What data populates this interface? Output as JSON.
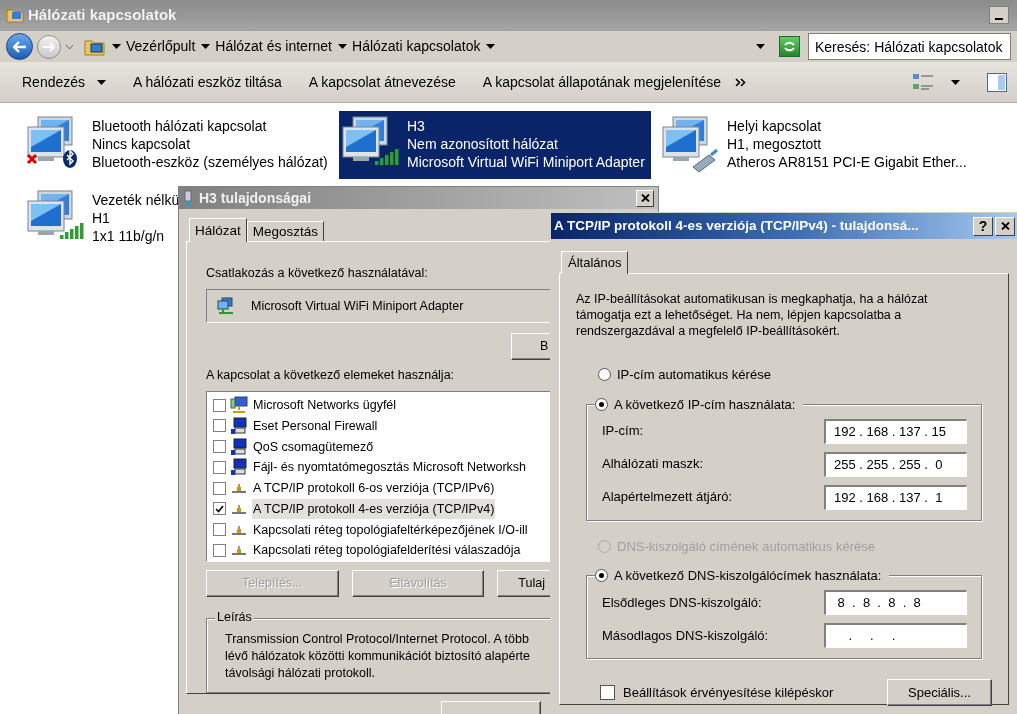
{
  "window": {
    "title": "Hálózati kapcsolatok"
  },
  "address_bar": {
    "breadcrumb": [
      "Vezérlőpult",
      "Hálózat és internet",
      "Hálózati kapcsolatok"
    ],
    "search": {
      "placeholder": "Keresés: Hálózati kapcsolatok"
    }
  },
  "toolbar": {
    "items": [
      {
        "label": "Rendezés",
        "dropdown": true
      },
      {
        "label": "A hálózati eszköz tiltása",
        "dropdown": false
      },
      {
        "label": "A kapcsolat átnevezése",
        "dropdown": false
      },
      {
        "label": "A kapcsolat állapotának megjelenítése",
        "dropdown": false
      }
    ]
  },
  "connections": [
    {
      "kind": "bluetooth",
      "name": "Bluetooth hálózati kapcsolat",
      "status": "Nincs kapcsolat",
      "device": "Bluetooth-eszköz (személyes hálózat)",
      "selected": false
    },
    {
      "kind": "wifi",
      "name": "H3",
      "status": "Nem azonosított hálózat",
      "device": "Microsoft Virtual WiFi Miniport Adapter",
      "selected": true
    },
    {
      "kind": "ethernet",
      "name": "Helyi kapcsolat",
      "status": "H1, megosztott",
      "device": "Atheros AR8151 PCI-E Gigabit Ether...",
      "selected": false
    },
    {
      "kind": "wifi",
      "name": "Vezeték nélkü",
      "status": "H1",
      "device": "1x1 11b/g/n",
      "selected": false
    }
  ],
  "properties_dialog": {
    "title": "H3 tulajdonságai",
    "tabs": [
      {
        "label": "Hálózat",
        "selected": true
      },
      {
        "label": "Megosztás",
        "selected": false
      }
    ],
    "connect_label": "Csatlakozás a következő használatával:",
    "adapter": "Microsoft Virtual WiFi Miniport Adapter",
    "configure_button": "B",
    "components_label": "A kapcsolat a következő elemeket használja:",
    "components": [
      {
        "kind": "client",
        "label": "Microsoft Networks ügyfél",
        "checked": false,
        "selected": false
      },
      {
        "kind": "service",
        "label": "Eset Personal Firewall",
        "checked": false,
        "selected": false
      },
      {
        "kind": "service",
        "label": "QoS csomagütemező",
        "checked": false,
        "selected": false
      },
      {
        "kind": "service",
        "label": "Fájl- és nyomtatómegosztás Microsoft Networksh",
        "checked": false,
        "selected": false
      },
      {
        "kind": "protocol",
        "label": "A TCP/IP protokoll 6-os verziója (TCP/IPv6)",
        "checked": false,
        "selected": false
      },
      {
        "kind": "protocol",
        "label": "A TCP/IP protokoll 4-es verziója (TCP/IPv4)",
        "checked": true,
        "selected": true
      },
      {
        "kind": "protocol",
        "label": "Kapcsolati réteg topológiafeltérképezőjének I/O-ill",
        "checked": false,
        "selected": false
      },
      {
        "kind": "protocol",
        "label": "Kapcsolati réteg topológiafelderítési válaszadója",
        "checked": false,
        "selected": false
      }
    ],
    "buttons": [
      {
        "label": "Telepítés...",
        "disabled": true
      },
      {
        "label": "Eltávolítás",
        "disabled": true
      },
      {
        "label": "Tulaj",
        "disabled": false
      }
    ],
    "description": {
      "legend": "Leírás",
      "lines": [
        "Transmission Control Protocol/Internet Protocol. A több",
        "lévő hálózatok közötti kommunikációt biztosító alapérte",
        "távolsági hálózati protokoll."
      ]
    }
  },
  "ipv4_dialog": {
    "title": "A TCP/IP protokoll 4-es verziója (TCP/IPv4) - tulajdonsá...",
    "help_button": "?",
    "tabs": [
      {
        "label": "Általános",
        "selected": true
      }
    ],
    "intro": "Az IP-beállításokat automatikusan is megkaphatja, ha a hálózat támogatja ezt a lehetőséget. Ha nem, lépjen kapcsolatba a rendszergazdával a megfelelő IP-beállításokért.",
    "ip_auto": {
      "label": "IP-cím automatikus kérése",
      "selected": false,
      "disabled": false
    },
    "ip_manual": {
      "label": "A következő IP-cím használata:",
      "selected": true,
      "disabled": false,
      "fields": [
        {
          "label": "IP-cím:",
          "value": "192 . 168 . 137 . 15"
        },
        {
          "label": "Alhálózati maszk:",
          "value": "255 . 255 . 255 .  0"
        },
        {
          "label": "Alapértelmezett átjáró:",
          "value": "192 . 168 . 137 .  1"
        }
      ]
    },
    "dns_auto": {
      "label": "DNS-kiszolgáló címének automatikus kérése",
      "selected": false,
      "disabled": true
    },
    "dns_manual": {
      "label": "A következő DNS-kiszolgálócímek használata:",
      "selected": true,
      "disabled": false,
      "fields": [
        {
          "label": "Elsődleges DNS-kiszolgáló:",
          "value": " 8  .  8  .  8  .  8"
        },
        {
          "label": "Másodlagos DNS-kiszolgáló:",
          "value": "    .     .     ."
        }
      ]
    },
    "validate": {
      "label": "Beállítások érvényesítése kilépéskor",
      "checked": false
    },
    "advanced_button": "Speciális..."
  }
}
